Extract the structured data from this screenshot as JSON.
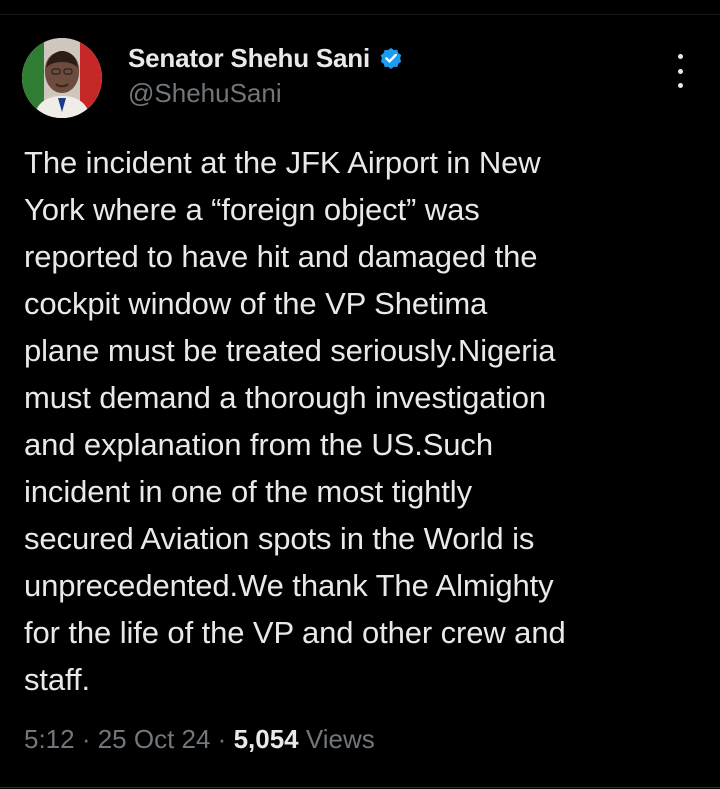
{
  "author": {
    "display_name": "Senator Shehu Sani",
    "handle": "@ShehuSani",
    "verified": true,
    "avatar_icon": "profile-photo"
  },
  "tweet": {
    "text": "The incident at the JFK Airport in New\nYork where a “foreign object” was\nreported to have hit and damaged the\ncockpit window of the VP Shetima\nplane must be treated seriously.Nigeria\nmust demand a thorough investigation\nand explanation from the US.Such\nincident in one of the most tightly\nsecured Aviation spots in the World is\nunprecedented.We thank The Almighty\nfor the life of the VP and other crew and\nstaff."
  },
  "meta": {
    "time": "5:12",
    "separator": " · ",
    "date": "25 Oct 24",
    "views_count": "5,054",
    "views_label": " Views"
  },
  "colors": {
    "background": "#000000",
    "text": "#e7e9ea",
    "secondary": "#71767b",
    "verified_badge": "#1d9bf0"
  },
  "icons": {
    "more": "more-options-icon",
    "verified": "verified-badge-icon"
  }
}
